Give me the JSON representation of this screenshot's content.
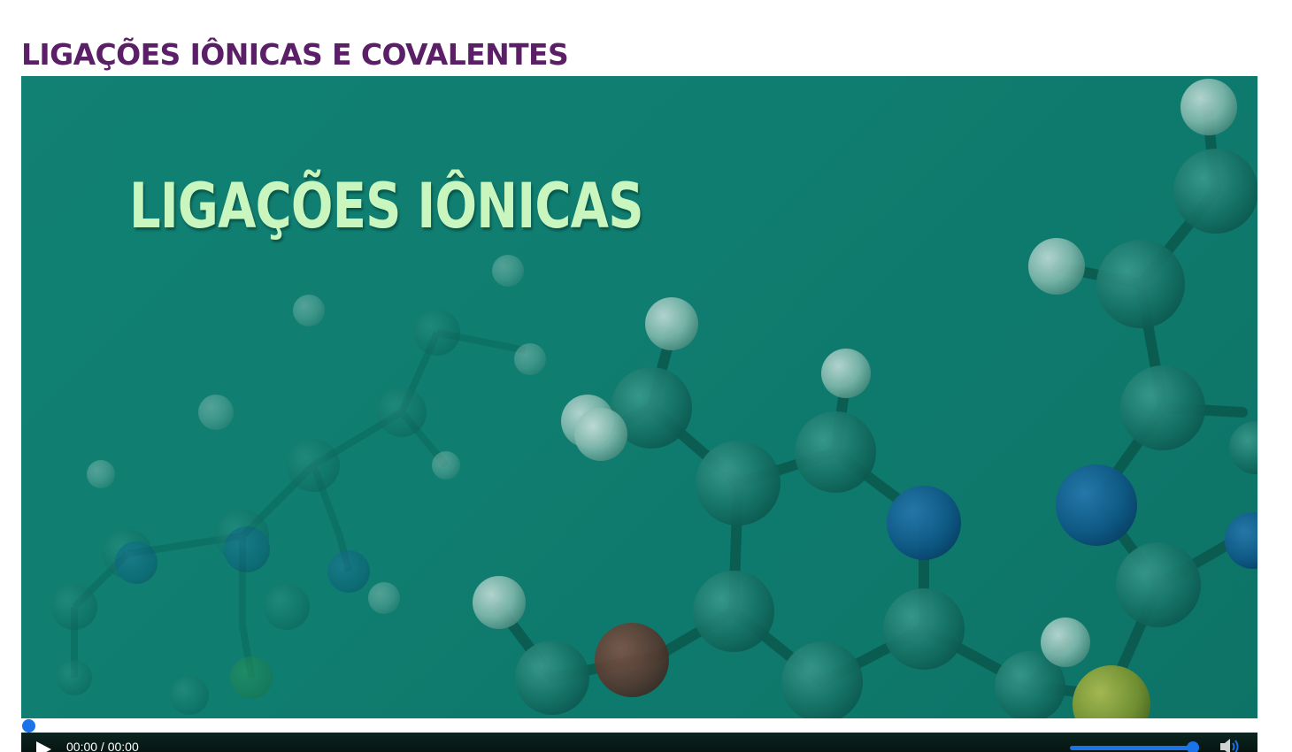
{
  "page": {
    "title": "LIGAÇÕES IÔNICAS E COVALENTES"
  },
  "video": {
    "slide_title": "LIGAÇÕES IÔNICAS",
    "time_display": "00:00 / 00:00",
    "progress": 0,
    "volume": 1.0,
    "state": "paused"
  },
  "icons": {
    "play": "play-icon",
    "volume": "volume-icon"
  },
  "colors": {
    "heading": "#5a1f66",
    "slide_background": "#118577",
    "slide_text": "#c9f5bf",
    "accent": "#1a73e8",
    "control_bar": "#061512"
  }
}
